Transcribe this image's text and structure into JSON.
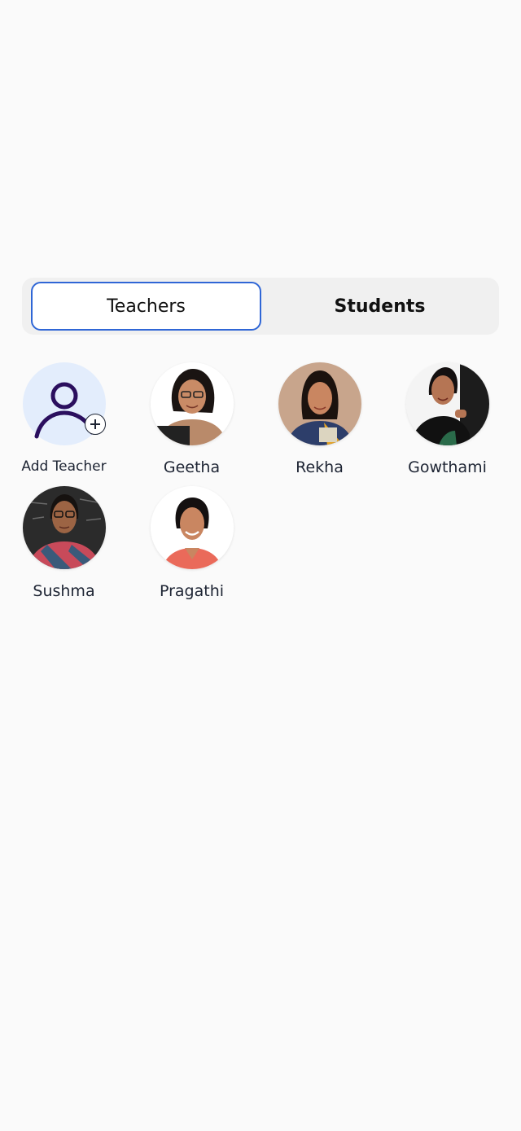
{
  "tabs": {
    "teachers": "Teachers",
    "students": "Students",
    "active": "Teachers"
  },
  "add_tile": {
    "label": "Add Teacher",
    "icon": "add-user-icon",
    "background_color": "#e3edfc",
    "icon_color": "#2b0f5e"
  },
  "teachers": [
    {
      "name": "Geetha",
      "photo": "geetha-photo"
    },
    {
      "name": "Rekha",
      "photo": "rekha-photo"
    },
    {
      "name": "Gowthami",
      "photo": "gowthami-photo"
    },
    {
      "name": "Sushma",
      "photo": "sushma-photo"
    },
    {
      "name": "Pragathi",
      "photo": "pragathi-photo"
    }
  ],
  "colors": {
    "accent": "#2f66d6",
    "page_background": "#fafafa",
    "segment_background": "#f0f0f0",
    "name_text": "#1d2433"
  }
}
